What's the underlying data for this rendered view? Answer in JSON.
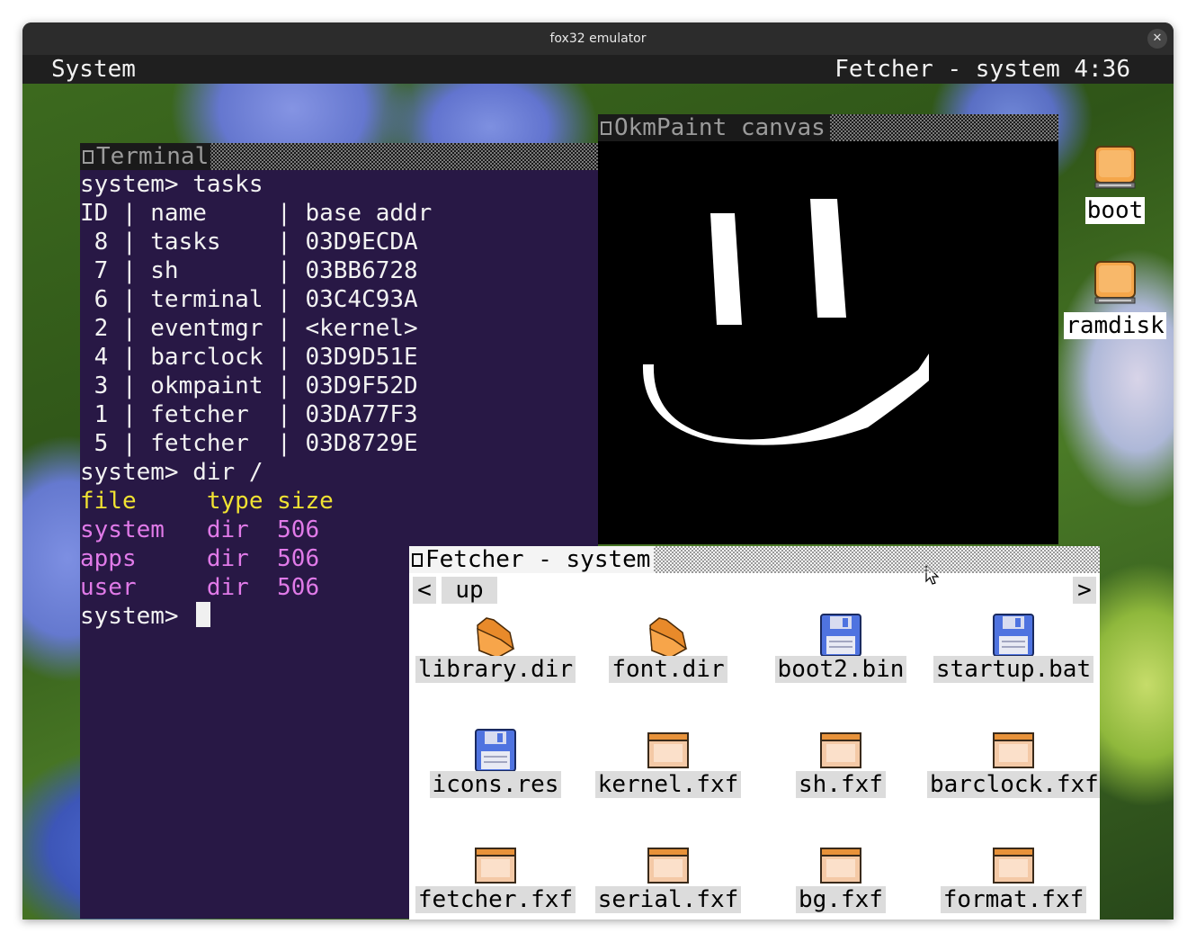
{
  "window": {
    "title": "fox32 emulator",
    "close_glyph": "✕"
  },
  "menubar": {
    "left": "System",
    "right": "Fetcher - system 4:36"
  },
  "desktop": {
    "icons": [
      {
        "label": "boot",
        "icon": "drive-icon"
      },
      {
        "label": "ramdisk",
        "icon": "drive-icon"
      }
    ]
  },
  "terminal": {
    "title": "Terminal",
    "lines": [
      {
        "text": "system> tasks",
        "color": "default"
      },
      {
        "text": "ID | name     | base addr",
        "color": "default"
      },
      {
        "text": " 8 | tasks    | 03D9ECDA",
        "color": "default"
      },
      {
        "text": " 7 | sh       | 03BB6728",
        "color": "default"
      },
      {
        "text": " 6 | terminal | 03C4C93A",
        "color": "default"
      },
      {
        "text": " 2 | eventmgr | <kernel>",
        "color": "default"
      },
      {
        "text": " 4 | barclock | 03D9D51E",
        "color": "default"
      },
      {
        "text": " 3 | okmpaint | 03D9F52D",
        "color": "default"
      },
      {
        "text": " 1 | fetcher  | 03DA77F3",
        "color": "default"
      },
      {
        "text": " 5 | fetcher  | 03D8729E",
        "color": "default"
      },
      {
        "text": "system> dir /",
        "color": "default"
      },
      {
        "text": "file     type size",
        "color": "yellow"
      },
      {
        "text": "system   dir  506",
        "color": "pink"
      },
      {
        "text": "apps     dir  506",
        "color": "pink"
      },
      {
        "text": "user     dir  506",
        "color": "pink"
      }
    ],
    "prompt": "system> "
  },
  "paint": {
    "title": "OkmPaint canvas"
  },
  "fetcher": {
    "title": "Fetcher - system",
    "nav": {
      "back": "<",
      "up": "up",
      "forward": ">"
    },
    "items": [
      {
        "label": "library.dir",
        "icon": "folder-icon"
      },
      {
        "label": "font.dir",
        "icon": "folder-icon"
      },
      {
        "label": "boot2.bin",
        "icon": "floppy-icon"
      },
      {
        "label": "startup.bat",
        "icon": "floppy-icon"
      },
      {
        "label": "icons.res",
        "icon": "floppy-icon"
      },
      {
        "label": "kernel.fxf",
        "icon": "app-window-icon"
      },
      {
        "label": "sh.fxf",
        "icon": "app-window-icon"
      },
      {
        "label": "barclock.fxf",
        "icon": "app-window-icon"
      },
      {
        "label": "fetcher.fxf",
        "icon": "app-window-icon"
      },
      {
        "label": "serial.fxf",
        "icon": "app-window-icon"
      },
      {
        "label": "bg.fxf",
        "icon": "app-window-icon"
      },
      {
        "label": "format.fxf",
        "icon": "app-window-icon"
      }
    ]
  }
}
